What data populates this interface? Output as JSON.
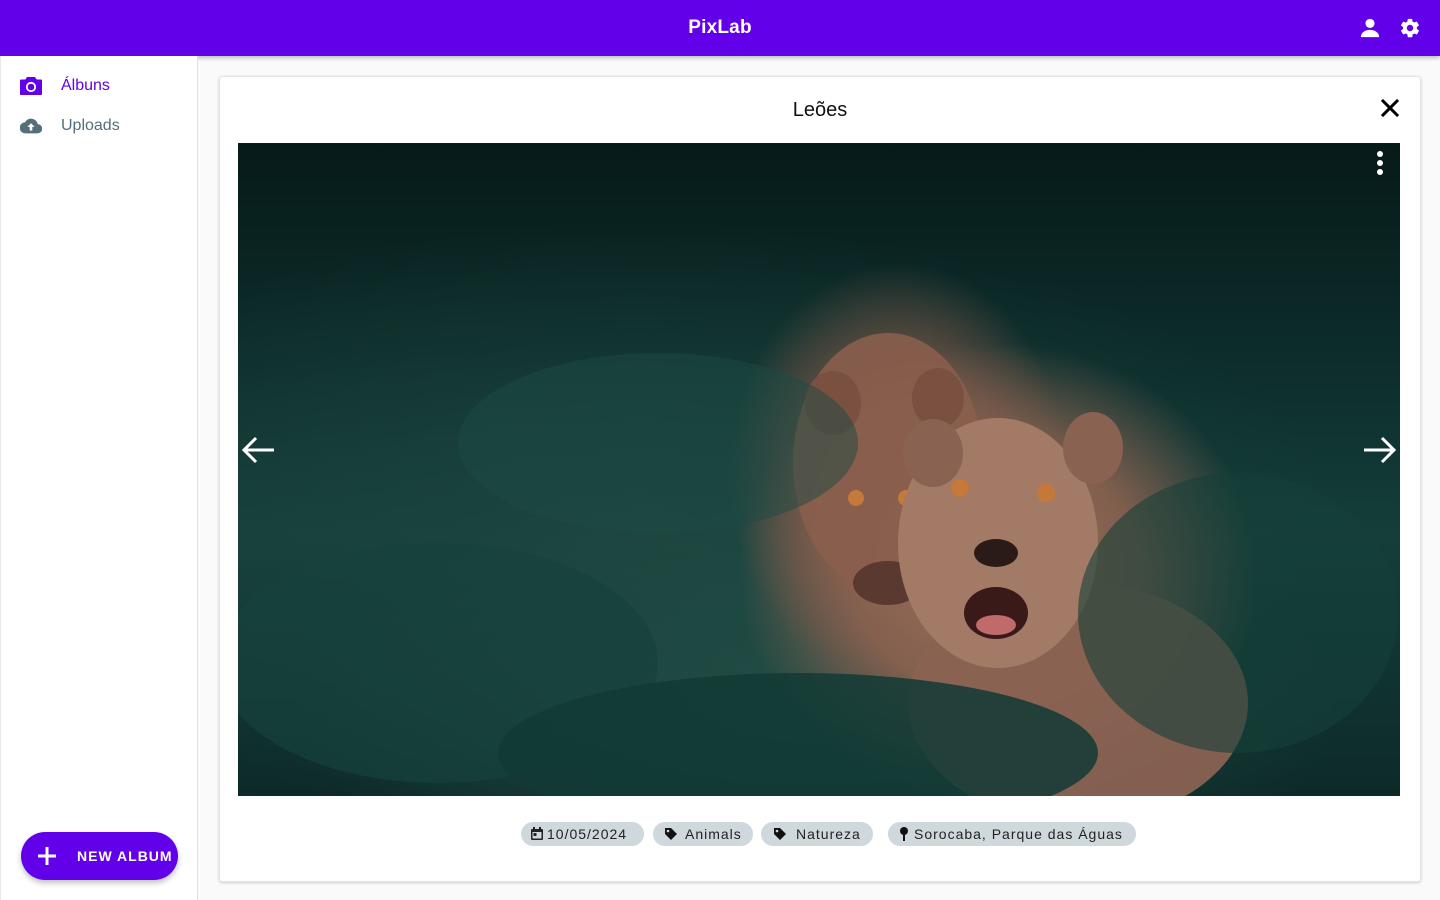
{
  "app": {
    "title": "PixLab"
  },
  "header": {
    "user_icon": "account-icon",
    "settings_icon": "gear-icon"
  },
  "sidebar": {
    "items": [
      {
        "label": "Álbuns",
        "icon": "camera-icon",
        "active": true
      },
      {
        "label": "Uploads",
        "icon": "cloud-upload-icon",
        "active": false
      }
    ],
    "fab_label": "NEW ALBUM"
  },
  "viewer": {
    "title": "Leões",
    "chips": {
      "date": "10/05/2024",
      "tag_1": "Animals",
      "tag_2": "Natureza",
      "location": "Sorocaba, Parque das Águas"
    }
  },
  "colors": {
    "primary": "#6200ea",
    "chip": "#cfd8dc",
    "secondary_text": "#546e7a"
  }
}
